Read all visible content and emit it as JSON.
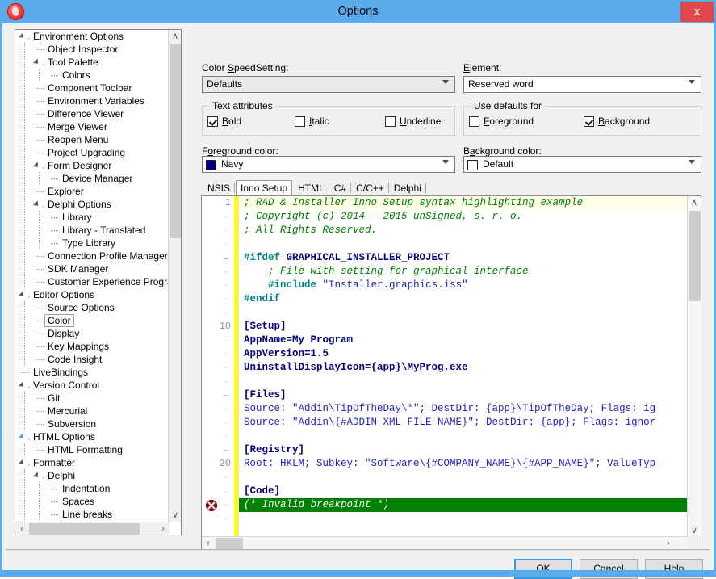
{
  "window": {
    "title": "Options",
    "app_icon": "app-logo-icon",
    "close_label": "x"
  },
  "tree": {
    "items": [
      {
        "label": "Environment Options",
        "depth": 0,
        "expander": "expanded",
        "selected": false
      },
      {
        "label": "Object Inspector",
        "depth": 1,
        "expander": "none",
        "selected": false
      },
      {
        "label": "Tool Palette",
        "depth": 1,
        "expander": "expanded",
        "selected": false
      },
      {
        "label": "Colors",
        "depth": 2,
        "expander": "none",
        "selected": false
      },
      {
        "label": "Component Toolbar",
        "depth": 1,
        "expander": "none",
        "selected": false
      },
      {
        "label": "Environment Variables",
        "depth": 1,
        "expander": "none",
        "selected": false
      },
      {
        "label": "Difference Viewer",
        "depth": 1,
        "expander": "none",
        "selected": false
      },
      {
        "label": "Merge Viewer",
        "depth": 1,
        "expander": "none",
        "selected": false
      },
      {
        "label": "Reopen Menu",
        "depth": 1,
        "expander": "none",
        "selected": false
      },
      {
        "label": "Project Upgrading",
        "depth": 1,
        "expander": "none",
        "selected": false
      },
      {
        "label": "Form Designer",
        "depth": 1,
        "expander": "expanded",
        "selected": false
      },
      {
        "label": "Device Manager",
        "depth": 2,
        "expander": "none",
        "selected": false
      },
      {
        "label": "Explorer",
        "depth": 1,
        "expander": "none",
        "selected": false
      },
      {
        "label": "Delphi Options",
        "depth": 1,
        "expander": "expanded",
        "selected": false
      },
      {
        "label": "Library",
        "depth": 2,
        "expander": "none",
        "selected": false
      },
      {
        "label": "Library - Translated",
        "depth": 2,
        "expander": "none",
        "selected": false
      },
      {
        "label": "Type Library",
        "depth": 2,
        "expander": "none",
        "selected": false
      },
      {
        "label": "Connection Profile Manager",
        "depth": 1,
        "expander": "none",
        "selected": false
      },
      {
        "label": "SDK Manager",
        "depth": 1,
        "expander": "none",
        "selected": false
      },
      {
        "label": "Customer Experience Program",
        "depth": 1,
        "expander": "none",
        "selected": false
      },
      {
        "label": "Editor Options",
        "depth": 0,
        "expander": "expanded",
        "selected": false
      },
      {
        "label": "Source Options",
        "depth": 1,
        "expander": "none",
        "selected": false
      },
      {
        "label": "Color",
        "depth": 1,
        "expander": "none",
        "selected": true
      },
      {
        "label": "Display",
        "depth": 1,
        "expander": "none",
        "selected": false
      },
      {
        "label": "Key Mappings",
        "depth": 1,
        "expander": "none",
        "selected": false
      },
      {
        "label": "Code Insight",
        "depth": 1,
        "expander": "none",
        "selected": false
      },
      {
        "label": "LiveBindings",
        "depth": 0,
        "expander": "none",
        "selected": false
      },
      {
        "label": "Version Control",
        "depth": 0,
        "expander": "expanded",
        "selected": false
      },
      {
        "label": "Git",
        "depth": 1,
        "expander": "none",
        "selected": false
      },
      {
        "label": "Mercurial",
        "depth": 1,
        "expander": "none",
        "selected": false
      },
      {
        "label": "Subversion",
        "depth": 1,
        "expander": "none",
        "selected": false
      },
      {
        "label": "HTML Options",
        "depth": 0,
        "expander": "expanded-hot",
        "selected": false
      },
      {
        "label": "HTML Formatting",
        "depth": 1,
        "expander": "none",
        "selected": false
      },
      {
        "label": "Formatter",
        "depth": 0,
        "expander": "expanded",
        "selected": false
      },
      {
        "label": "Delphi",
        "depth": 1,
        "expander": "expanded",
        "selected": false
      },
      {
        "label": "Indentation",
        "depth": 2,
        "expander": "none",
        "selected": false
      },
      {
        "label": "Spaces",
        "depth": 2,
        "expander": "none",
        "selected": false
      },
      {
        "label": "Line breaks",
        "depth": 2,
        "expander": "none",
        "selected": false
      }
    ],
    "scroll_up": "∧",
    "scroll_down": "∨",
    "scroll_left": "‹",
    "scroll_right": "›"
  },
  "form": {
    "speedsetting_label": "Color SpeedSetting:",
    "speedsetting_value": "Defaults",
    "element_label": "Element:",
    "element_value": "Reserved word",
    "text_attributes_title": "Text attributes",
    "bold_label": "Bold",
    "bold_checked": true,
    "italic_label": "Italic",
    "italic_checked": false,
    "underline_label": "Underline",
    "underline_checked": false,
    "use_defaults_title": "Use defaults for",
    "foreground_default_label": "Foreground",
    "foreground_default_checked": false,
    "background_default_label": "Background",
    "background_default_checked": true,
    "foreground_color_label": "Foreground color:",
    "foreground_color_value": "Navy",
    "foreground_color_hex": "#000080",
    "background_color_label": "Background color:",
    "background_color_value": "Default",
    "background_color_hex": "#ffffff"
  },
  "tabs": [
    {
      "label": "NSIS",
      "active": false
    },
    {
      "label": "Inno Setup",
      "active": true
    },
    {
      "label": "HTML",
      "active": false
    },
    {
      "label": "C#",
      "active": false
    },
    {
      "label": "C/C++",
      "active": false
    },
    {
      "label": "Delphi",
      "active": false
    }
  ],
  "editor": {
    "gutter_numbers": {
      "1": 1,
      "10": 10,
      "20": 20
    },
    "breakpoint_line": 22,
    "breakpoint_icon": "invalid-breakpoint-icon",
    "fold_lines": [
      5,
      15,
      19
    ],
    "lines": [
      {
        "n": 1,
        "text": "; RAD & Installer Inno Setup syntax highlighting example"
      },
      {
        "n": 2,
        "text": "; Copyright (c) 2014 - 2015 unSigned, s. r. o."
      },
      {
        "n": 3,
        "text": "; All Rights Reserved."
      },
      {
        "n": 4,
        "text": ""
      },
      {
        "n": 5,
        "text": "#ifdef GRAPHICAL_INSTALLER_PROJECT"
      },
      {
        "n": 6,
        "text": "    ; File with setting for graphical interface"
      },
      {
        "n": 7,
        "text": "    #include \"Installer.graphics.iss\""
      },
      {
        "n": 8,
        "text": "#endif"
      },
      {
        "n": 9,
        "text": ""
      },
      {
        "n": 10,
        "text": "[Setup]"
      },
      {
        "n": 11,
        "text": "AppName=My Program"
      },
      {
        "n": 12,
        "text": "AppVersion=1.5"
      },
      {
        "n": 13,
        "text": "UninstallDisplayIcon={app}\\MyProg.exe"
      },
      {
        "n": 14,
        "text": ""
      },
      {
        "n": 15,
        "text": "[Files]"
      },
      {
        "n": 16,
        "text": "Source: \"Addin\\TipOfTheDay\\*\"; DestDir: {app}\\TipOfTheDay; Flags: ig"
      },
      {
        "n": 17,
        "text": "Source: \"Addin\\{#ADDIN_XML_FILE_NAME}\"; DestDir: {app}; Flags: ignor"
      },
      {
        "n": 18,
        "text": ""
      },
      {
        "n": 19,
        "text": "[Registry]"
      },
      {
        "n": 20,
        "text": "Root: HKLM; Subkey: \"Software\\{#COMPANY_NAME}\\{#APP_NAME}\"; ValueTyp"
      },
      {
        "n": 21,
        "text": ""
      },
      {
        "n": 22,
        "text": "[Code]"
      },
      {
        "n": 23,
        "text": "(* Invalid breakpoint *)"
      },
      {
        "n": 24,
        "text": ""
      }
    ],
    "colors": {
      "comment": "#008000",
      "keyword": "#000080",
      "directive": "#008080",
      "string": "#2222cc",
      "current_line_bg": "#ffffea",
      "breakpoint_bg": "#008000",
      "gutter_bar": "#ffff00"
    }
  },
  "buttons": {
    "ok": "OK",
    "cancel": "Cancel",
    "help": "Help"
  }
}
